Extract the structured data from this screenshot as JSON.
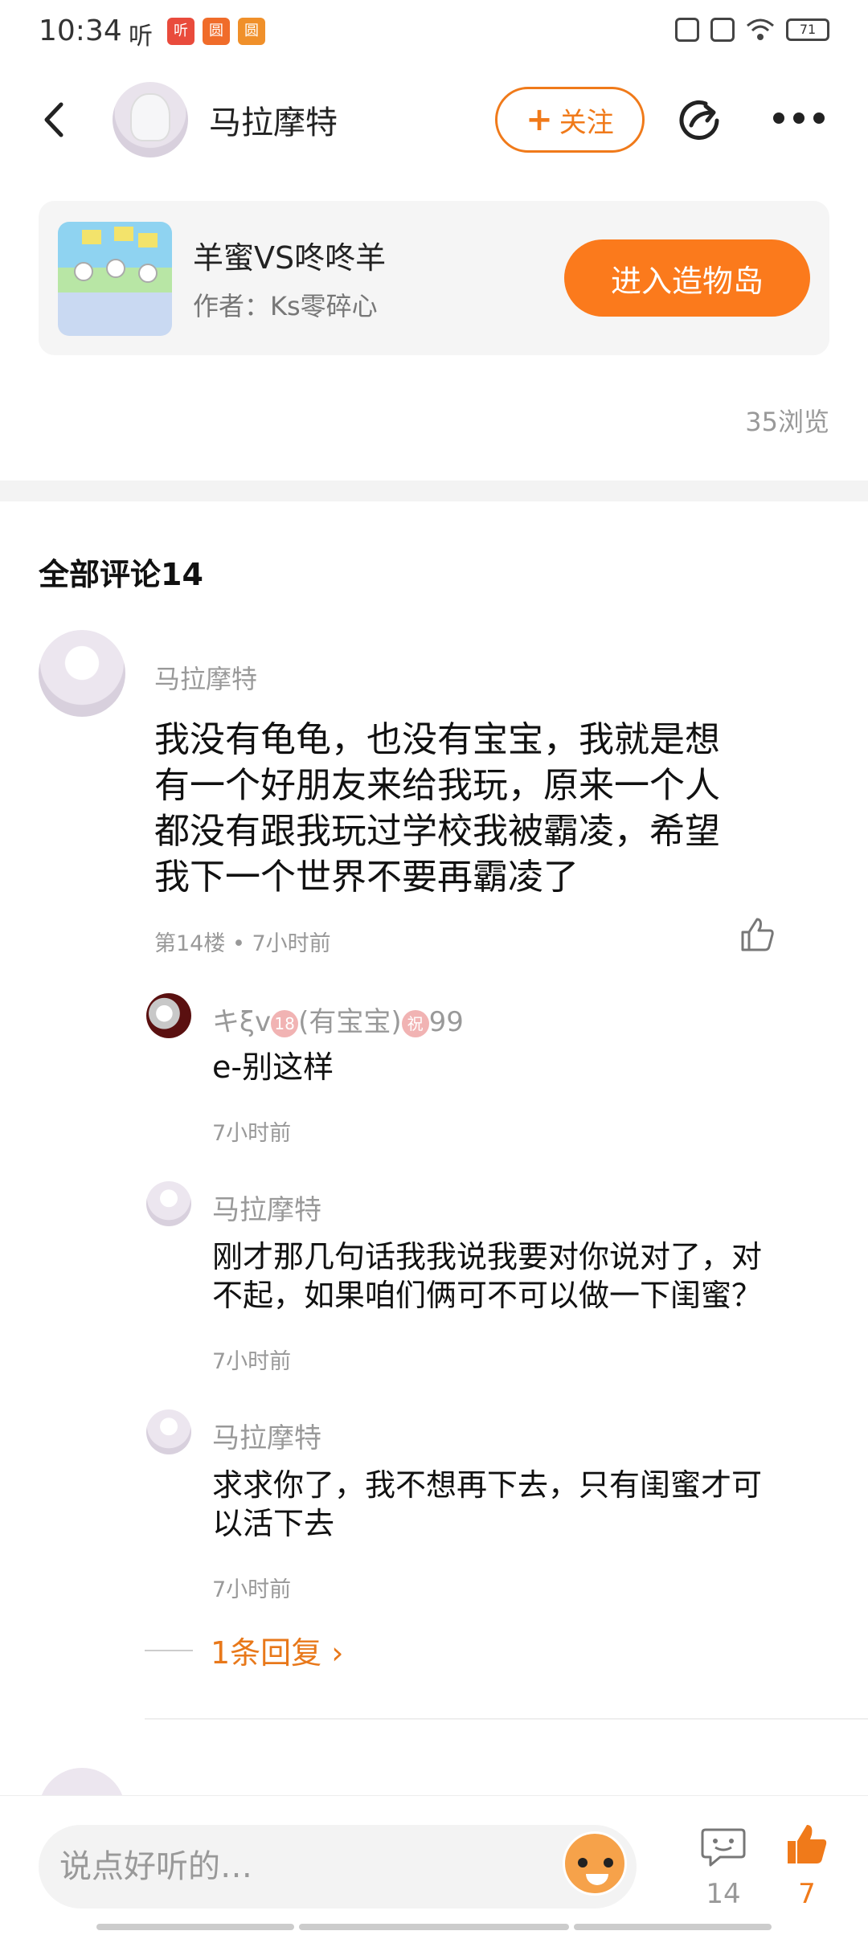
{
  "status_bar": {
    "time": "10:34",
    "ting": "听",
    "battery": "71",
    "apps": [
      {
        "label": "听",
        "color": "#e94b3c"
      },
      {
        "label": "圆",
        "color": "#f06c2a"
      },
      {
        "label": "圆",
        "color": "#f0902a"
      }
    ]
  },
  "header": {
    "username": "马拉摩特",
    "follow_label": "关注",
    "follow_plus": "+"
  },
  "game_card": {
    "title": "羊蜜VS咚咚羊",
    "author": "作者：Ks零碎心",
    "enter_label": "进入造物岛"
  },
  "views": "35浏览",
  "comments_header": "全部评论14",
  "main_comment": {
    "author": "马拉摩特",
    "text_lines": [
      "我没有龟龟，也没有宝宝，我就是想",
      "有一个好朋友来给我玩，原来一个人",
      "都没有跟我玩过学校我被霸凌，希望",
      "我下一个世界不要再霸凌了"
    ],
    "meta": "第14楼 • 7小时前"
  },
  "replies": [
    {
      "author_prefix": "キξv",
      "badge1": "18",
      "author_mid": "(有宝宝)",
      "badge2": "祝",
      "author_suffix": "99",
      "text_lines": [
        "e-别这样"
      ],
      "time": "7小时前"
    },
    {
      "author": "马拉摩特",
      "text_lines": [
        "刚才那几句话我我说我要对你说对了，对",
        "不起，如果咱们俩可不可以做一下闺蜜？"
      ],
      "time": "7小时前"
    },
    {
      "author": "马拉摩特",
      "text_lines": [
        "求求你了，我不想再下去，只有闺蜜才可",
        "以活下去"
      ],
      "time": "7小时前"
    }
  ],
  "more_replies": "1条回复",
  "more_replies_chevron": "›",
  "bottom_bar": {
    "input_placeholder": "说点好听的…",
    "comment_count": "14",
    "like_count": "7"
  },
  "colors": {
    "accent": "#f07a1a",
    "enter_button": "#fb7a1c"
  }
}
